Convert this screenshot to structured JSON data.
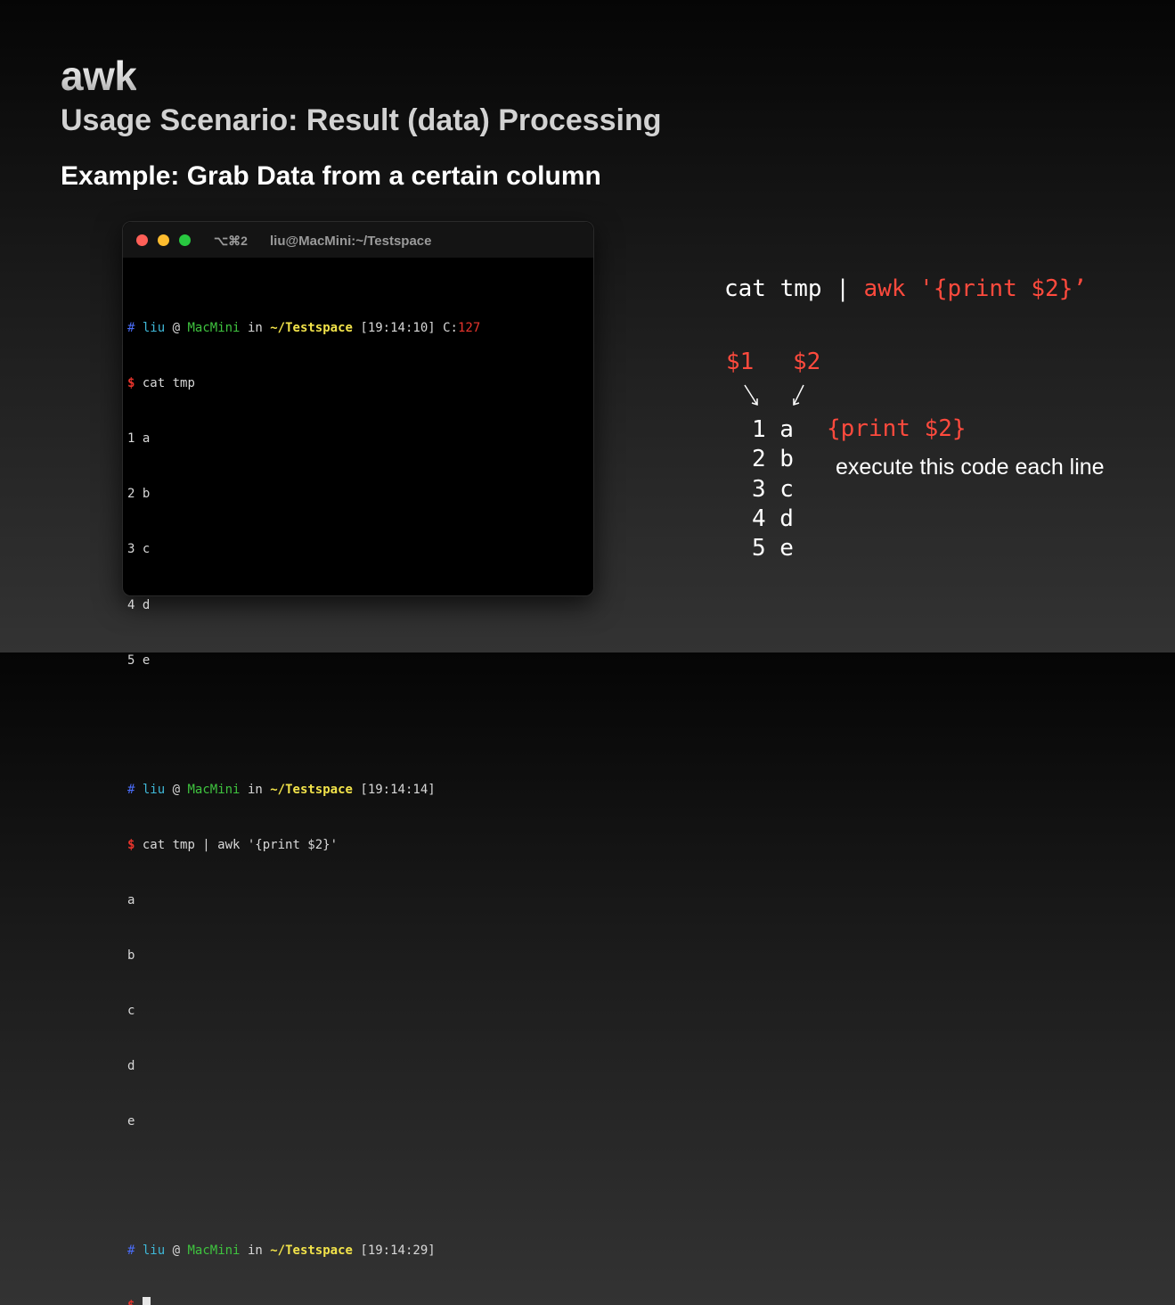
{
  "slide": {
    "title": "awk",
    "subtitle": "Usage Scenario: Result (data) Processing",
    "example": "Example: Grab Data from a certain column"
  },
  "terminal": {
    "shortcut": "⌥⌘2",
    "title": "liu@MacMini:~/Testspace",
    "prompt": {
      "hash": "#",
      "user": "liu",
      "at": "@",
      "host": "MacMini",
      "in": "in",
      "dir": "~/Testspace",
      "dollar": "$"
    },
    "blocks": [
      {
        "time": "[19:14:10]",
        "code_label": "C:",
        "code_value": "127",
        "command": "cat tmp",
        "output": [
          "1 a",
          "2 b",
          "3 c",
          "4 d",
          "5 e"
        ]
      },
      {
        "time": "[19:14:14]",
        "command": "cat tmp | awk '{print $2}'",
        "output": [
          "a",
          "b",
          "c",
          "d",
          "e"
        ]
      },
      {
        "time": "[19:14:29]",
        "command": ""
      }
    ]
  },
  "explanation": {
    "command_plain": "cat tmp | ",
    "command_awk": "awk '{print $2}’",
    "field1": "$1",
    "field2": "$2",
    "rows": [
      "1 a",
      "2 b",
      "3 c",
      "4 d",
      "5 e"
    ],
    "print_code": "{print $2}",
    "note": "execute this code each line"
  },
  "colors": {
    "accent_red": "#ff4a3d",
    "prompt_user": "#3fb8d8",
    "prompt_host": "#3fc33f",
    "prompt_dir": "#f2e34a",
    "prompt_hash": "#4a6cf7"
  }
}
